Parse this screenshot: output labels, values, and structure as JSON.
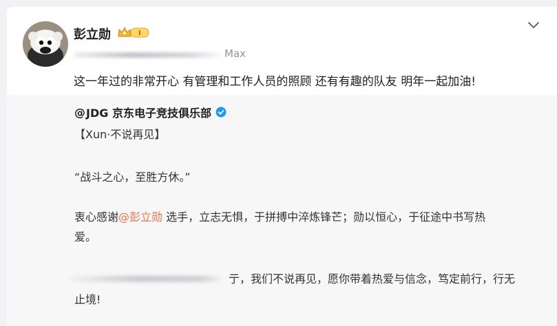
{
  "post": {
    "author_name": "彭立勋",
    "device": "Max",
    "text": "这一年过的非常开心 有管理和工作人员的照顾 还有有趣的队友 明年一起加油!",
    "badge_level": "I"
  },
  "repost": {
    "author_at": "@",
    "author_name": "JDG 京东电子竞技俱乐部",
    "title": "【Xun·不说再见】",
    "quote": "“战斗之心，至胜方休。”",
    "thanks_prefix": "衷心感谢",
    "mention": "@彭立勋",
    "thanks_suffix": "选手，立志无惧，于拼搏中淬炼锋芒；勋以恒心，于征途中书写热",
    "thanks_wrap": "爱。",
    "farewell_visible": "亍，我们不说再见，愿你带着热爱与信念，笃定前行，行无",
    "farewell_wrap": "止境!"
  },
  "icons": {
    "collapse": "chevron-down-icon",
    "verified": "verified-badge-icon",
    "vip": "vip-crown-badge-icon"
  },
  "colors": {
    "mention": "#eb7350",
    "verified_blue": "#1d9bf0",
    "badge_gold": "#f5b335"
  }
}
